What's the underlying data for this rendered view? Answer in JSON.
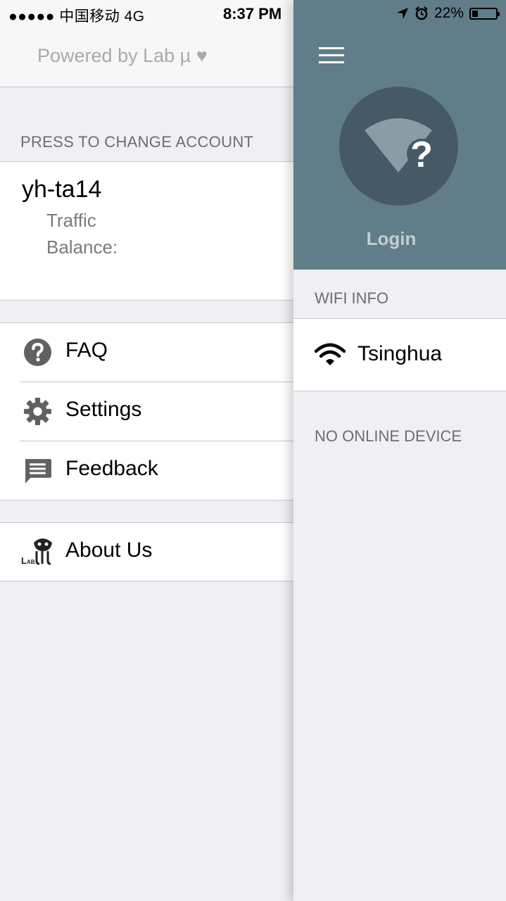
{
  "status": {
    "carrier": "●●●●● 中国移动   4G",
    "time": "8:37 PM",
    "battery": "22%"
  },
  "left": {
    "powered_by": "Powered by Lab µ ♥",
    "account_section": "PRESS TO CHANGE ACCOUNT",
    "account": {
      "username": "yh-ta14",
      "traffic_label": "Traffic",
      "balance_label": "Balance:"
    },
    "menu": [
      {
        "label": "FAQ",
        "icon": "help-icon"
      },
      {
        "label": "Settings",
        "icon": "gear-icon"
      },
      {
        "label": "Feedback",
        "icon": "chat-icon"
      }
    ],
    "about": {
      "label": "About Us",
      "icon": "lab-logo"
    }
  },
  "right": {
    "login_label": "Login",
    "wifi_section": "WIFI INFO",
    "wifi_name": "Tsinghua",
    "no_device": "NO ONLINE DEVICE"
  },
  "colors": {
    "header_bg": "#617d8a",
    "circle_bg": "#455a66",
    "icon_gray": "#616161"
  }
}
